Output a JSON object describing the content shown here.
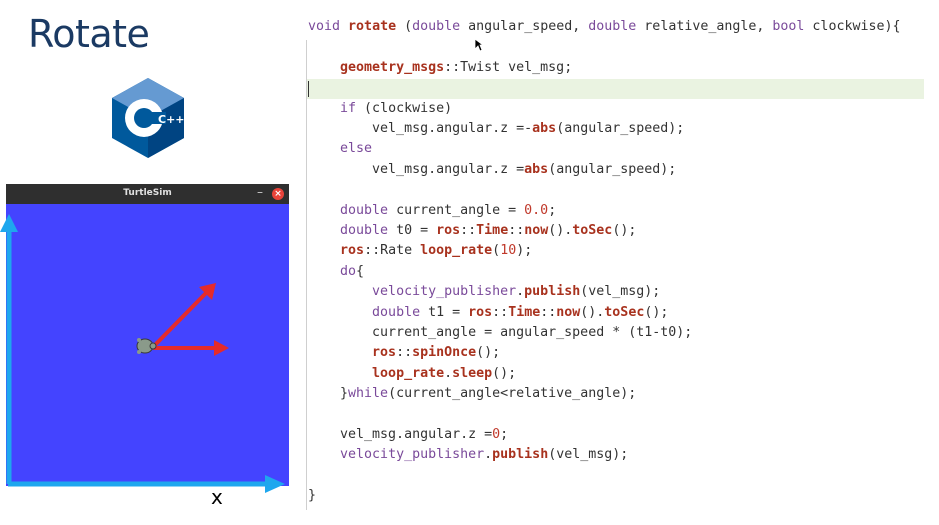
{
  "slide": {
    "title": "Rotate"
  },
  "logo": {
    "text": "C++",
    "icon": "cpp-logo-icon"
  },
  "turtlesim": {
    "window_title": "TurtleSim",
    "minimize": "–",
    "close": "×",
    "x_axis_label": "x",
    "background": "#4444ff"
  },
  "code": {
    "lines": [
      "void rotate (double angular_speed, double relative_angle, bool clockwise){",
      "",
      "    geometry_msgs::Twist vel_msg;",
      "",
      "    if (clockwise)",
      "        vel_msg.angular.z =-abs(angular_speed);",
      "    else",
      "        vel_msg.angular.z =abs(angular_speed);",
      "",
      "    double current_angle = 0.0;",
      "    double t0 = ros::Time::now().toSec();",
      "    ros::Rate loop_rate(10);",
      "    do{",
      "        velocity_publisher.publish(vel_msg);",
      "        double t1 = ros::Time::now().toSec();",
      "        current_angle = angular_speed * (t1-t0);",
      "        ros::spinOnce();",
      "        loop_rate.sleep();",
      "    }while(current_angle<relative_angle);",
      "",
      "    vel_msg.angular.z =0;",
      "    velocity_publisher.publish(vel_msg);",
      "",
      "}"
    ]
  }
}
